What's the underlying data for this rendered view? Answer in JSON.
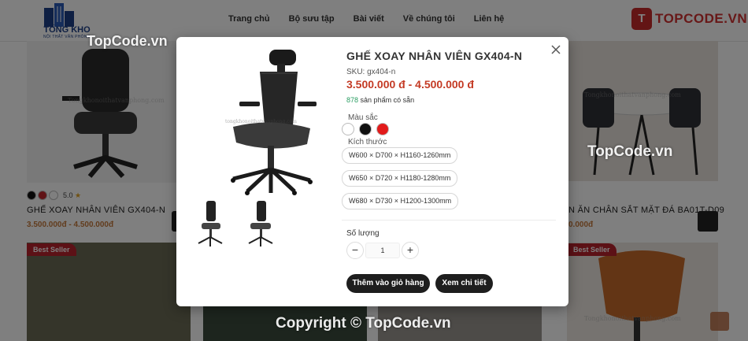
{
  "header": {
    "logo_text": "TỔNG KHO",
    "logo_sub": "NỘI THẤT VĂN PHÒNG",
    "nav": [
      "Trang chủ",
      "Bộ sưu tập",
      "Bài viết",
      "Về chúng tôi",
      "Liên hệ"
    ],
    "badge_text": "TOPCODE.VN"
  },
  "background_products": {
    "left_card": {
      "rating": "5.0",
      "title": "GHẾ XOAY NHÂN VIÊN GX404-N",
      "price": "3.500.000đ - 4.500.000đ",
      "swatch_colors": [
        "#111111",
        "#c0272d",
        "#ffffff"
      ]
    },
    "right_card": {
      "title": "N ĂN CHÂN SẮT MẶT ĐÁ BA01T-D09",
      "price": "0.000đ"
    },
    "badges": [
      "Best Seller",
      "Best Seller"
    ]
  },
  "watermarks": {
    "topcode_1": "TopCode.vn",
    "topcode_2": "TopCode.vn",
    "copyright": "Copyright © TopCode.vn",
    "site": "Tongkhonoithatvanphong.com"
  },
  "modal": {
    "title": "GHẾ XOAY NHÂN VIÊN GX404-N",
    "sku_label": "SKU:",
    "sku": "gx404-n",
    "price": "3.500.000 đ - 4.500.000 đ",
    "stock_count": "878",
    "stock_text": "sản phẩm có sẵn",
    "color_label": "Màu sắc",
    "colors": [
      {
        "name": "Trắng",
        "hex": "#ffffff"
      },
      {
        "name": "Đen",
        "hex": "#111111"
      },
      {
        "name": "Đỏ",
        "hex": "#e21b1b"
      }
    ],
    "size_label": "Kích thước",
    "sizes": [
      "W600 × D700 × H1160-1260mm",
      "W650 × D720 × H1180-1280mm",
      "W680 × D730 × H1200-1300mm"
    ],
    "qty_label": "Số lượng",
    "qty_value": "1",
    "qty_minus": "−",
    "qty_plus": "+",
    "add_to_cart": "Thêm vào giỏ hàng",
    "view_detail": "Xem chi tiết",
    "image_watermark": "tongkhonoithatvanphong.com"
  }
}
